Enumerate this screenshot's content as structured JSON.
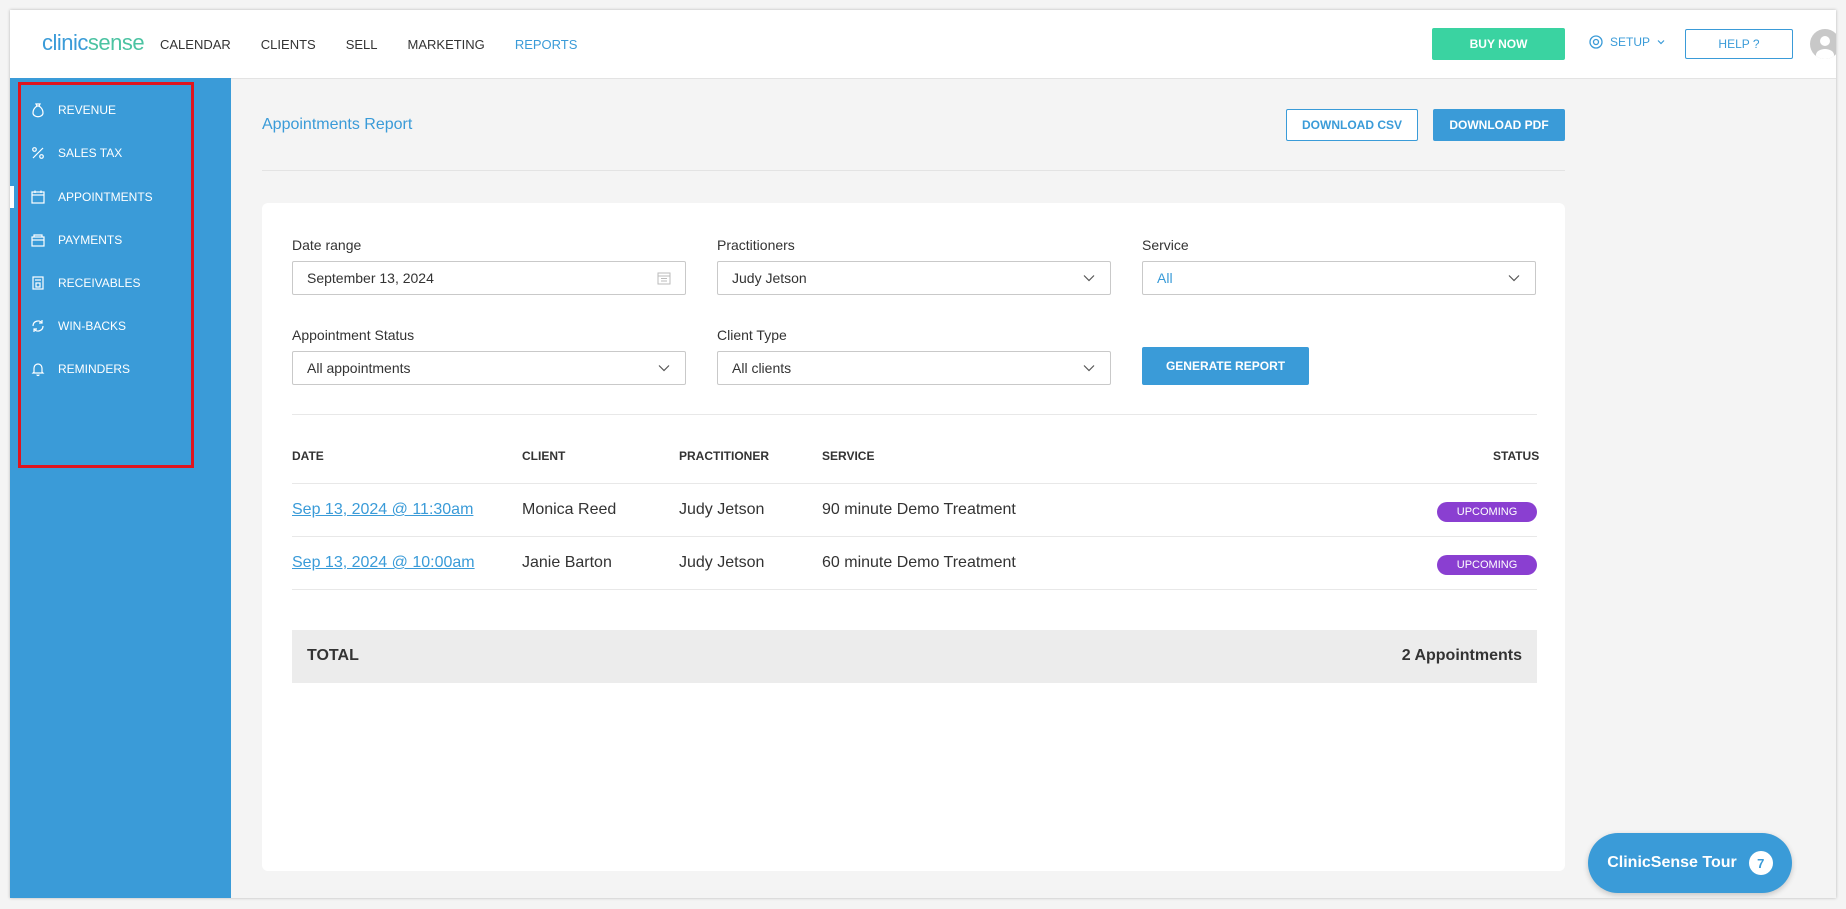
{
  "logo": {
    "prefix": "clinic",
    "suffix": "sense"
  },
  "nav": {
    "items": [
      {
        "label": "CALENDAR"
      },
      {
        "label": "CLIENTS"
      },
      {
        "label": "SELL"
      },
      {
        "label": "MARKETING"
      },
      {
        "label": "REPORTS"
      }
    ],
    "buy_label": "BUY NOW",
    "setup_label": "SETUP",
    "help_label": "HELP ?"
  },
  "sidebar": {
    "items": [
      {
        "label": "REVENUE",
        "icon": "money-bag-icon"
      },
      {
        "label": "SALES TAX",
        "icon": "percent-icon"
      },
      {
        "label": "APPOINTMENTS",
        "icon": "calendar-icon"
      },
      {
        "label": "PAYMENTS",
        "icon": "wallet-icon"
      },
      {
        "label": "RECEIVABLES",
        "icon": "receipt-icon"
      },
      {
        "label": "WIN-BACKS",
        "icon": "refresh-icon"
      },
      {
        "label": "REMINDERS",
        "icon": "bell-icon"
      }
    ]
  },
  "page": {
    "title": "Appointments Report",
    "download_csv": "DOWNLOAD CSV",
    "download_pdf": "DOWNLOAD PDF"
  },
  "filters": {
    "date_range_label": "Date range",
    "date_range_value": "September 13, 2024",
    "practitioners_label": "Practitioners",
    "practitioners_value": "Judy Jetson",
    "service_label": "Service",
    "service_value": "All",
    "status_label": "Appointment Status",
    "status_value": "All appointments",
    "client_type_label": "Client Type",
    "client_type_value": "All clients",
    "generate_label": "GENERATE REPORT"
  },
  "table": {
    "headers": {
      "date": "DATE",
      "client": "CLIENT",
      "practitioner": "PRACTITIONER",
      "service": "SERVICE",
      "status": "STATUS"
    },
    "rows": [
      {
        "date": "Sep 13, 2024 @ 11:30am",
        "client": "Monica Reed",
        "practitioner": "Judy Jetson",
        "service": "90 minute Demo Treatment",
        "status": "UPCOMING"
      },
      {
        "date": "Sep 13, 2024 @ 10:00am",
        "client": "Janie Barton",
        "practitioner": "Judy Jetson",
        "service": "60 minute Demo Treatment",
        "status": "UPCOMING"
      }
    ],
    "total_label": "TOTAL",
    "total_value": "2 Appointments"
  },
  "tour": {
    "label": "ClinicSense Tour",
    "count": "7"
  },
  "colors": {
    "primary": "#3a9bd8",
    "buy": "#3ad3a1",
    "badge": "#8a3fd1",
    "highlight": "#e0141e"
  }
}
